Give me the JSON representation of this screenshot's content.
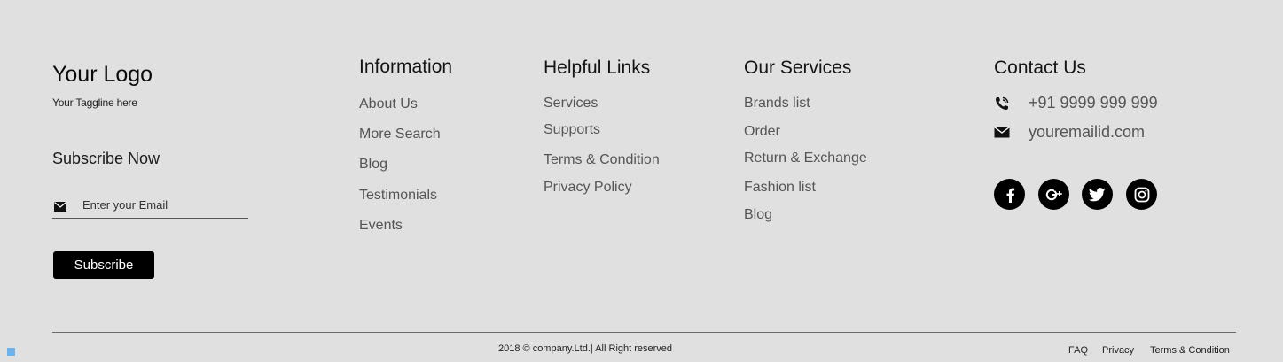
{
  "brand": {
    "logo": "Your Logo",
    "tagline": "Your Taggline here"
  },
  "subscribe": {
    "title": "Subscribe Now",
    "email_placeholder": "Enter your Email",
    "button_label": "Subscribe"
  },
  "information": {
    "title": "Information",
    "links": [
      "About Us",
      "More Search",
      "Blog",
      "Testimonials",
      "Events"
    ]
  },
  "helpful_links": {
    "title": "Helpful Links",
    "links": [
      "Services",
      "Supports",
      "Terms & Condition",
      "Privacy Policy"
    ]
  },
  "our_services": {
    "title": "Our Services",
    "links": [
      "Brands list",
      "Order",
      "Return & Exchange",
      "Fashion list",
      "Blog"
    ]
  },
  "contact": {
    "title": "Contact Us",
    "phone": "+91 9999 999 999",
    "email": "youremailid.com",
    "social_icons": [
      "facebook-icon",
      "google-plus-icon",
      "twitter-icon",
      "instagram-icon"
    ]
  },
  "footer_bottom": {
    "copyright": "2018 © company.Ltd.| All Right reserved",
    "links": [
      "FAQ",
      "Privacy",
      "Terms & Condition"
    ]
  },
  "colors": {
    "background": "#e0e0e0",
    "button_bg": "#000000",
    "link_text": "#555555",
    "corner_handle": "#6cb3f0"
  }
}
